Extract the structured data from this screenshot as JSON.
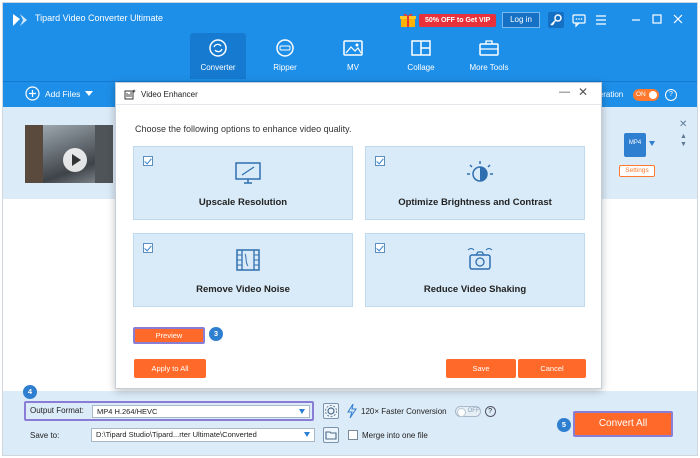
{
  "app": {
    "title": "Tipard Video Converter Ultimate",
    "promo": "50% OFF to Get VIP",
    "login": "Log in",
    "brand_color": "#1e8fe8",
    "accent_color": "#ff6a2a"
  },
  "nav": [
    {
      "label": "Converter",
      "icon": "converter-icon",
      "active": true
    },
    {
      "label": "Ripper",
      "icon": "ripper-icon"
    },
    {
      "label": "MV",
      "icon": "mv-icon"
    },
    {
      "label": "Collage",
      "icon": "collage-icon"
    },
    {
      "label": "More Tools",
      "icon": "toolbox-icon"
    }
  ],
  "toolbar": {
    "add_files": "Add Files",
    "acceleration": "leration",
    "toggle": "ON",
    "help": "?"
  },
  "file_row": {
    "format": "MP4",
    "settings": "Settings"
  },
  "dialog": {
    "title": "Video Enhancer",
    "subtitle": "Choose the following options to enhance video quality.",
    "options": [
      {
        "label": "Upscale Resolution",
        "checked": true,
        "icon": "monitor-icon"
      },
      {
        "label": "Optimize Brightness and Contrast",
        "checked": true,
        "icon": "brightness-icon"
      },
      {
        "label": "Remove Video Noise",
        "checked": true,
        "icon": "film-icon"
      },
      {
        "label": "Reduce Video Shaking",
        "checked": true,
        "icon": "camera-shake-icon"
      }
    ],
    "preview": "Preview",
    "apply_all": "Apply to All",
    "save": "Save",
    "cancel": "Cancel"
  },
  "steps": {
    "preview": "3",
    "output": "4",
    "convert": "5"
  },
  "bottom": {
    "output_format_label": "Output Format:",
    "output_format_value": "MP4 H.264/HEVC",
    "faster": "120× Faster Conversion",
    "faster_toggle": "OFF",
    "help": "?",
    "save_to_label": "Save to:",
    "save_to_value": "D:\\Tipard Studio\\Tipard...rter Ultimate\\Converted",
    "merge": "Merge into one file",
    "convert_all": "Convert All"
  }
}
